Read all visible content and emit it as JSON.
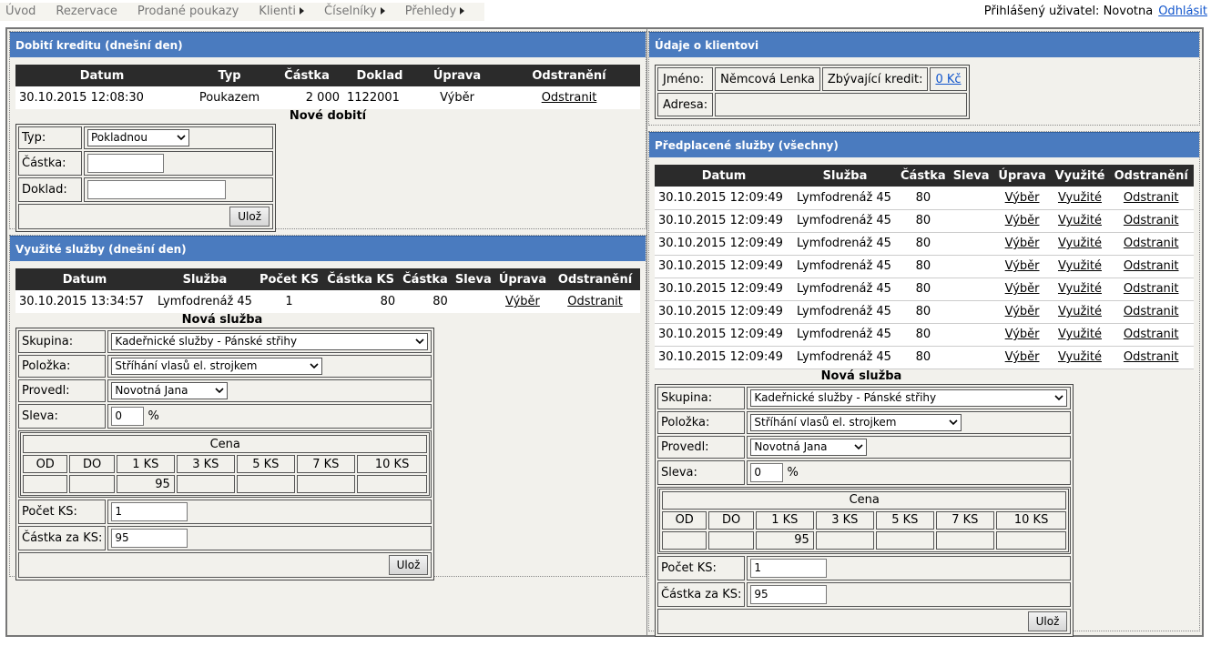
{
  "menu": {
    "items": [
      "Úvod",
      "Rezervace",
      "Prodané poukazy",
      "Klienti",
      "Číselníky",
      "Přehledy"
    ],
    "user_label": "Přihlášený uživatel: Novotna",
    "logout": "Odhlásit"
  },
  "credit": {
    "title": "Dobití kreditu (dnešní den)",
    "headers": [
      "Datum",
      "Typ",
      "Částka",
      "Doklad",
      "Úprava",
      "Odstranění"
    ],
    "row": {
      "datum": "30.10.2015 12:08:30",
      "typ": "Poukazem",
      "castka": "2 000",
      "doklad": "1122001",
      "uprava": "Výběr",
      "odstraneni": "Odstranit"
    },
    "form": {
      "heading": "Nové dobití",
      "typ_label": "Typ:",
      "typ_value": "Pokladnou",
      "castka_label": "Částka:",
      "doklad_label": "Doklad:",
      "save": "Ulož"
    }
  },
  "used": {
    "title": "Využité služby (dnešní den)",
    "headers": [
      "Datum",
      "Služba",
      "Počet KS",
      "Částka KS",
      "Částka",
      "Sleva",
      "Úprava",
      "Odstranění"
    ],
    "row": {
      "datum": "30.10.2015 13:34:57",
      "sluzba": "Lymfodrenáž 45",
      "pocet": "1",
      "castka_ks": "80",
      "castka": "80",
      "sleva": "",
      "uprava": "Výběr",
      "odstraneni": "Odstranit"
    }
  },
  "service_form": {
    "heading": "Nová služba",
    "skupina_label": "Skupina:",
    "skupina_value": "Kadeřnické služby - Pánské střihy",
    "polozka_label": "Položka:",
    "polozka_value": "Stříhání vlasů el. strojkem",
    "provedl_label": "Provedl:",
    "provedl_value": "Novotná Jana",
    "sleva_label": "Sleva:",
    "sleva_value": "0",
    "sleva_unit": "%",
    "cena_label": "Cena",
    "price_headers": [
      "OD",
      "DO",
      "1 KS",
      "3 KS",
      "5 KS",
      "7 KS",
      "10 KS"
    ],
    "price_values": [
      "",
      "",
      "95",
      "",
      "",
      "",
      ""
    ],
    "pocet_label": "Počet KS:",
    "pocet_value": "1",
    "castka_label": "Částka za KS:",
    "castka_value": "95",
    "save": "Ulož"
  },
  "client": {
    "title": "Údaje o klientovi",
    "jmeno_label": "Jméno:",
    "jmeno_value": "Němcová Lenka",
    "kredit_label": "Zbývající kredit:",
    "kredit_value": "0 Kč",
    "adresa_label": "Adresa:",
    "adresa_value": ""
  },
  "prepaid": {
    "title": "Předplacené služby (všechny)",
    "headers": [
      "Datum",
      "Služba",
      "Částka",
      "Sleva",
      "Úprava",
      "Využité",
      "Odstranění"
    ],
    "rows": [
      {
        "datum": "30.10.2015 12:09:49",
        "sluzba": "Lymfodrenáž 45",
        "castka": "80",
        "sleva": "",
        "uprava": "Výběr",
        "vyuzite": "Využité",
        "odstraneni": "Odstranit"
      },
      {
        "datum": "30.10.2015 12:09:49",
        "sluzba": "Lymfodrenáž 45",
        "castka": "80",
        "sleva": "",
        "uprava": "Výběr",
        "vyuzite": "Využité",
        "odstraneni": "Odstranit"
      },
      {
        "datum": "30.10.2015 12:09:49",
        "sluzba": "Lymfodrenáž 45",
        "castka": "80",
        "sleva": "",
        "uprava": "Výběr",
        "vyuzite": "Využité",
        "odstraneni": "Odstranit"
      },
      {
        "datum": "30.10.2015 12:09:49",
        "sluzba": "Lymfodrenáž 45",
        "castka": "80",
        "sleva": "",
        "uprava": "Výběr",
        "vyuzite": "Využité",
        "odstraneni": "Odstranit"
      },
      {
        "datum": "30.10.2015 12:09:49",
        "sluzba": "Lymfodrenáž 45",
        "castka": "80",
        "sleva": "",
        "uprava": "Výběr",
        "vyuzite": "Využité",
        "odstraneni": "Odstranit"
      },
      {
        "datum": "30.10.2015 12:09:49",
        "sluzba": "Lymfodrenáž 45",
        "castka": "80",
        "sleva": "",
        "uprava": "Výběr",
        "vyuzite": "Využité",
        "odstraneni": "Odstranit"
      },
      {
        "datum": "30.10.2015 12:09:49",
        "sluzba": "Lymfodrenáž 45",
        "castka": "80",
        "sleva": "",
        "uprava": "Výběr",
        "vyuzite": "Využité",
        "odstraneni": "Odstranit"
      },
      {
        "datum": "30.10.2015 12:09:49",
        "sluzba": "Lymfodrenáž 45",
        "castka": "80",
        "sleva": "",
        "uprava": "Výběr",
        "vyuzite": "Využité",
        "odstraneni": "Odstranit"
      }
    ]
  }
}
